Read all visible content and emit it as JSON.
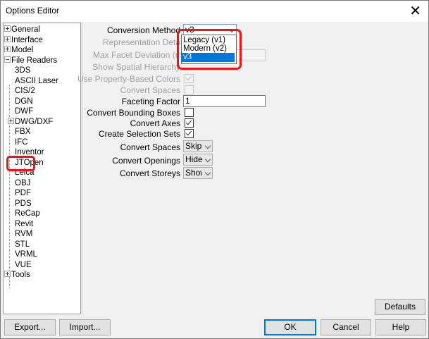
{
  "window": {
    "title": "Options Editor",
    "close_glyph": "✕"
  },
  "tree": {
    "items": [
      {
        "label": "General",
        "expander": "plus"
      },
      {
        "label": "Interface",
        "expander": "plus"
      },
      {
        "label": "Model",
        "expander": "plus"
      },
      {
        "label": "File Readers",
        "expander": "minus"
      },
      {
        "label": "3DS"
      },
      {
        "label": "ASCII Laser"
      },
      {
        "label": "CIS/2"
      },
      {
        "label": "DGN"
      },
      {
        "label": "DWF"
      },
      {
        "label": "DWG/DXF",
        "expander": "plus"
      },
      {
        "label": "FBX"
      },
      {
        "label": "IFC",
        "selected": true
      },
      {
        "label": "Inventor"
      },
      {
        "label": "JTOpen"
      },
      {
        "label": "Leica"
      },
      {
        "label": "OBJ"
      },
      {
        "label": "PDF"
      },
      {
        "label": "PDS"
      },
      {
        "label": "ReCap"
      },
      {
        "label": "Revit"
      },
      {
        "label": "RVM"
      },
      {
        "label": "STL"
      },
      {
        "label": "VRML"
      },
      {
        "label": "VUE"
      },
      {
        "label": "Tools",
        "expander": "plus"
      }
    ]
  },
  "settings": {
    "conversion_method": {
      "label": "Conversion Method",
      "value": "v3"
    },
    "representation_detail": {
      "label": "Representation Deta"
    },
    "max_facet_deviation": {
      "label": "Max Facet Deviation (m"
    },
    "show_spatial_hierarchy": {
      "label": "Show Spatial Hierarchy"
    },
    "use_property_colors": {
      "label": "Use Property-Based Colors",
      "checked": true
    },
    "convert_spaces_chk": {
      "label": "Convert Spaces",
      "checked": false
    },
    "faceting_factor": {
      "label": "Faceting Factor",
      "value": "1"
    },
    "convert_bounding_boxes": {
      "label": "Convert Bounding Boxes",
      "checked": false
    },
    "convert_axes": {
      "label": "Convert Axes",
      "checked": true
    },
    "create_selection_sets": {
      "label": "Create Selection Sets",
      "checked": true
    },
    "convert_spaces": {
      "label": "Convert Spaces",
      "value": "Skip"
    },
    "convert_openings": {
      "label": "Convert Openings",
      "value": "Hide"
    },
    "convert_storeys": {
      "label": "Convert Storeys",
      "value": "Show"
    }
  },
  "dropdown": {
    "options": [
      "Legacy (v1)",
      "Modern (v2)",
      "v3"
    ],
    "selected": "v3"
  },
  "buttons": {
    "defaults": "Defaults",
    "export": "Export...",
    "import": "Import...",
    "ok": "OK",
    "cancel": "Cancel",
    "help": "Help"
  },
  "colors": {
    "highlight_annotation": "#e8151b",
    "selection": "#0078d7"
  }
}
